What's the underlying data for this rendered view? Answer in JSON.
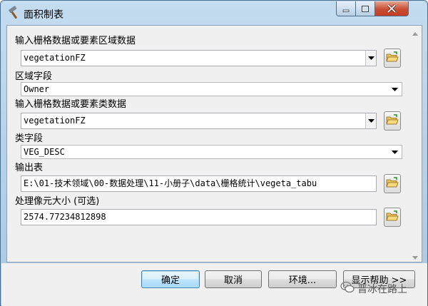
{
  "window": {
    "title": "面积制表",
    "title_icon": "hammer-icon",
    "controls": [
      "minimize-icon",
      "maximize-icon",
      "close-icon"
    ]
  },
  "form": {
    "zone_data": {
      "label": "输入栅格数据或要素区域数据",
      "value": "vegetationFZ"
    },
    "zone_field": {
      "label": "区域字段",
      "value": "Owner"
    },
    "class_data": {
      "label": "输入栅格数据或要素类数据",
      "value": "vegetationFZ"
    },
    "class_field": {
      "label": "类字段",
      "value": "VEG_DESC"
    },
    "output_table": {
      "label": "输出表",
      "value": "E:\\01-技术领域\\00-数据处理\\11-小册子\\data\\栅格统计\\vegeta_tabu"
    },
    "cell_size": {
      "label": "处理像元大小 (可选)",
      "value": "2574.77234812898"
    }
  },
  "buttons": {
    "ok": "确定",
    "cancel": "取消",
    "environments": "环境...",
    "show_help": "显示帮助 >>"
  },
  "watermark": {
    "text": "晋冰在路上",
    "icon": "wechat-icon"
  },
  "colors": {
    "window_frame": "#aac8e2",
    "client_bg": "#f0f0f0",
    "close_button": "#c94d33",
    "default_button_border": "#3c7fb1"
  }
}
